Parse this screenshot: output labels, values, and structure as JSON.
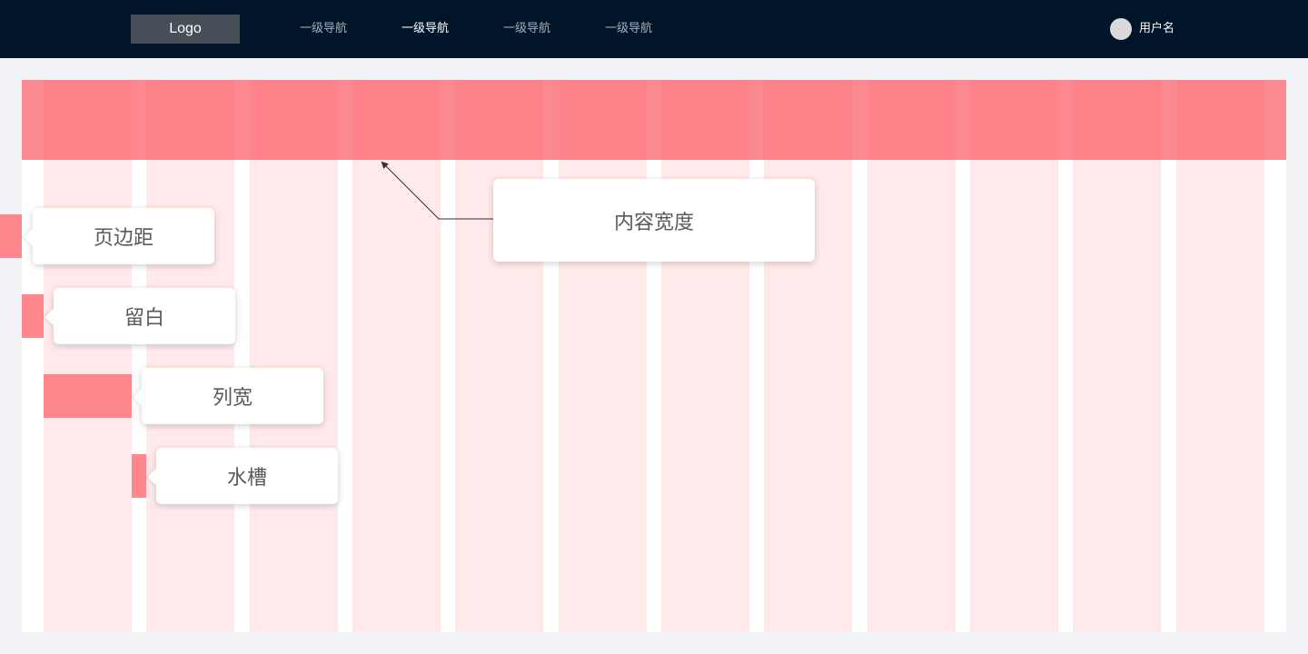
{
  "header": {
    "logo": "Logo",
    "nav": [
      {
        "label": "一级导航",
        "active": false
      },
      {
        "label": "一级导航",
        "active": true
      },
      {
        "label": "一级导航",
        "active": false
      },
      {
        "label": "一级导航",
        "active": false
      }
    ],
    "username": "用户名"
  },
  "labels": {
    "content_width": "内容宽度",
    "page_margin": "页边距",
    "padding": "留白",
    "column_width": "列宽",
    "gutter": "水槽"
  },
  "grid": {
    "columns": 12
  },
  "colors": {
    "nav_bg": "#001529",
    "page_bg": "#f0f2f5",
    "column_fill": "#ffe9ea",
    "highlight": "#fe868d",
    "label_text": "#595959"
  }
}
